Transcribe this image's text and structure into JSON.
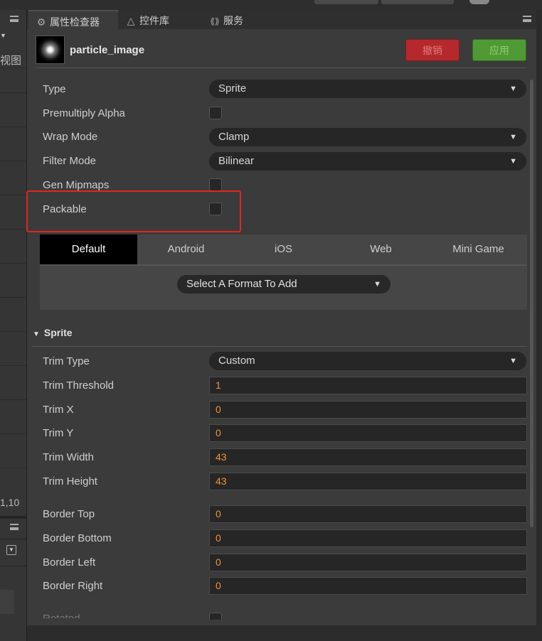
{
  "tabs": {
    "inspector": "属性检查器",
    "library": "控件库",
    "services": "服务"
  },
  "left_panel": {
    "view_label": "视图",
    "coord_value": "1,10"
  },
  "asset": {
    "name": "particle_image"
  },
  "header_buttons": {
    "revert": "撤销",
    "apply": "应用"
  },
  "texture": {
    "type_label": "Type",
    "type_value": "Sprite",
    "premultiply_label": "Premultiply Alpha",
    "premultiply_checked": false,
    "wrap_label": "Wrap Mode",
    "wrap_value": "Clamp",
    "filter_label": "Filter Mode",
    "filter_value": "Bilinear",
    "mipmaps_label": "Gen Mipmaps",
    "mipmaps_checked": false,
    "packable_label": "Packable",
    "packable_checked": false
  },
  "platforms": {
    "tabs": [
      "Default",
      "Android",
      "iOS",
      "Web",
      "Mini Game"
    ],
    "active": "Default",
    "format_select": "Select A Format To Add"
  },
  "sprite": {
    "header": "Sprite",
    "trim_type_label": "Trim Type",
    "trim_type_value": "Custom",
    "trim_threshold_label": "Trim Threshold",
    "trim_threshold_value": "1",
    "trim_x_label": "Trim X",
    "trim_x_value": "0",
    "trim_y_label": "Trim Y",
    "trim_y_value": "0",
    "trim_width_label": "Trim Width",
    "trim_width_value": "43",
    "trim_height_label": "Trim Height",
    "trim_height_value": "43",
    "border_top_label": "Border Top",
    "border_top_value": "0",
    "border_bottom_label": "Border Bottom",
    "border_bottom_value": "0",
    "border_left_label": "Border Left",
    "border_left_value": "0",
    "border_right_label": "Border Right",
    "border_right_value": "0",
    "rotated_label": "Rotated"
  },
  "colors": {
    "revert_button": "#b5292d",
    "apply_button": "#4f9a35",
    "number_value": "#f0933a",
    "highlight_box": "#e32521"
  },
  "icons": {
    "inspector": "gear-icon",
    "library": "triangle-icon",
    "services": "cloud-link-icon",
    "menu": "hamburger-menu-icon",
    "dropdown": "triangle-down-icon"
  }
}
